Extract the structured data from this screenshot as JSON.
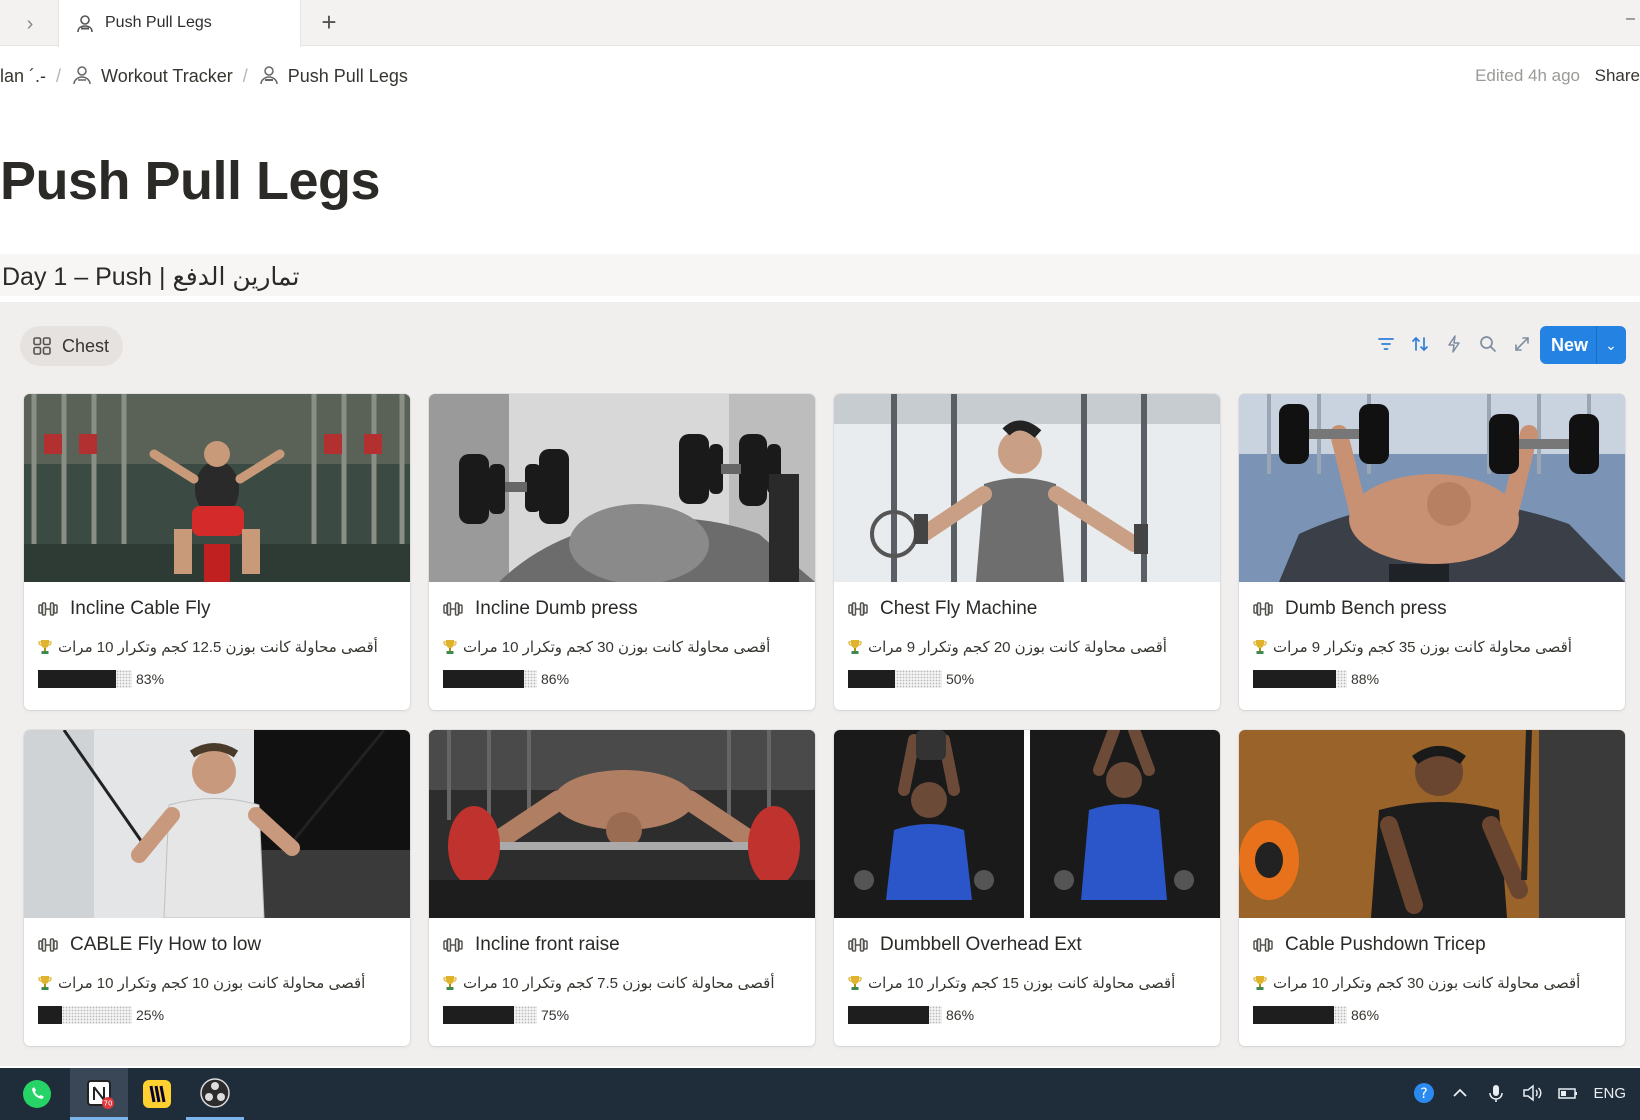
{
  "tabbar": {
    "tab_title": "Push Pull Legs",
    "tab_icon": "workout-person-icon",
    "new_tab_label": "+"
  },
  "breadcrumb": {
    "items": [
      {
        "label": "lan ´.-",
        "icon": ""
      },
      {
        "label": "Workout Tracker",
        "icon": "workout-tracker-icon"
      },
      {
        "label": "Push Pull Legs",
        "icon": "workout-person-icon"
      }
    ],
    "separator": "/",
    "edited": "Edited 4h ago",
    "share": "Share"
  },
  "page": {
    "title": "Push Pull Legs",
    "section_heading": "Day 1 – Push | تمارين الدفع"
  },
  "database": {
    "view_label": "Chest",
    "view_icon": "gallery-icon",
    "toolbar_icons": [
      "filter-icon",
      "sort-icon",
      "automation-icon",
      "search-icon",
      "expand-icon",
      "settings-icon"
    ],
    "new_button": "New",
    "accent": "#2483e2",
    "cards": [
      {
        "title": "Incline Cable Fly",
        "note": "أقصى محاولة كانت بوزن 12.5 كجم وتكرار 10 مرات",
        "progress": 0.83,
        "progress_label": "83%",
        "cover": "color-gym"
      },
      {
        "title": "Incline Dumb press",
        "note": "أقصى محاولة كانت بوزن 30 كجم وتكرار 10 مرات",
        "progress": 0.86,
        "progress_label": "86%",
        "cover": "bw-dumbbell-press"
      },
      {
        "title": "Chest Fly Machine",
        "note": "أقصى محاولة كانت بوزن 20 كجم وتكرار 9 مرات",
        "progress": 0.5,
        "progress_label": "50%",
        "cover": "light-gym"
      },
      {
        "title": "Dumb Bench press",
        "note": "أقصى محاولة كانت بوزن 35 كجم وتكرار 9 مرات",
        "progress": 0.88,
        "progress_label": "88%",
        "cover": "blue-bench"
      },
      {
        "title": "CABLE Fly How to low",
        "note": "أقصى محاولة كانت بوزن 10 كجم وتكرار 10 مرات",
        "progress": 0.25,
        "progress_label": "25%",
        "cover": "cable-gym"
      },
      {
        "title": "Incline front raise",
        "note": "أقصى محاولة كانت بوزن 7.5 كجم وتكرار 10 مرات",
        "progress": 0.75,
        "progress_label": "75%",
        "cover": "dark-bar"
      },
      {
        "title": "Dumbbell Overhead Ext",
        "note": "أقصى محاولة كانت بوزن 15 كجم وتكرار 10 مرات",
        "progress": 0.86,
        "progress_label": "86%",
        "cover": "blue-shirt-split"
      },
      {
        "title": "Cable Pushdown Tricep",
        "note": "أقصى محاولة كانت بوزن 30 كجم وتكرار 10 مرات",
        "progress": 0.86,
        "progress_label": "86%",
        "cover": "orange-gym"
      }
    ]
  },
  "taskbar": {
    "apps": [
      "whatsapp-icon",
      "notion-icon",
      "miro-icon",
      "obs-icon"
    ],
    "notion_badge": "70",
    "language": "ENG"
  }
}
